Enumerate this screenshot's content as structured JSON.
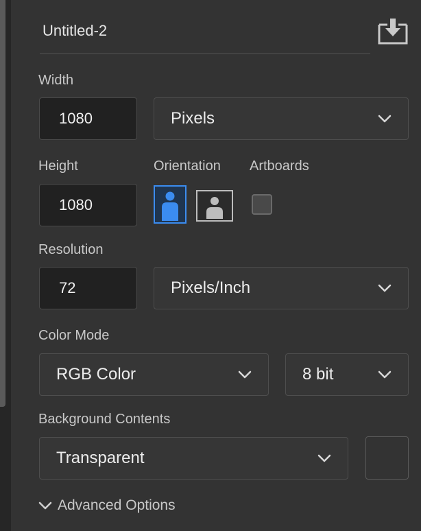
{
  "preset": {
    "name": "Untitled-2",
    "save_icon": "save-preset-icon"
  },
  "width": {
    "label": "Width",
    "value": "1080",
    "unit": "Pixels"
  },
  "height": {
    "label": "Height",
    "value": "1080"
  },
  "orientation": {
    "label": "Orientation",
    "selected": "portrait",
    "portrait_icon": "portrait-orientation-icon",
    "landscape_icon": "landscape-orientation-icon"
  },
  "artboards": {
    "label": "Artboards",
    "checked": false
  },
  "resolution": {
    "label": "Resolution",
    "value": "72",
    "unit": "Pixels/Inch"
  },
  "color_mode": {
    "label": "Color Mode",
    "mode": "RGB Color",
    "depth": "8 bit"
  },
  "background": {
    "label": "Background Contents",
    "value": "Transparent"
  },
  "advanced": {
    "label": "Advanced Options"
  },
  "colors": {
    "panel": "#333333",
    "input_bg": "#212121",
    "accent": "#3b8cf0"
  }
}
